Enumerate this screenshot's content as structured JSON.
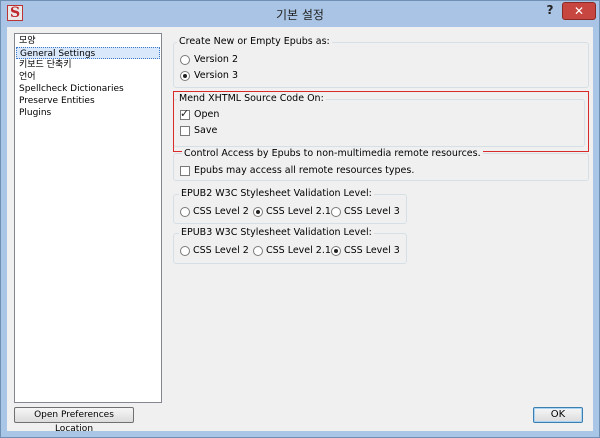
{
  "window": {
    "title": "기본 설정",
    "help_label": "?",
    "close_label": "✕",
    "app_icon_glyph": "S"
  },
  "sidebar": {
    "items": [
      {
        "label": "모양",
        "selected": false
      },
      {
        "label": "General Settings",
        "selected": true
      },
      {
        "label": "키보드 단축키",
        "selected": false
      },
      {
        "label": "언어",
        "selected": false
      },
      {
        "label": "Spellcheck Dictionaries",
        "selected": false
      },
      {
        "label": "Preserve Entities",
        "selected": false
      },
      {
        "label": "Plugins",
        "selected": false
      }
    ]
  },
  "epub_version": {
    "title": "Create New or Empty Epubs as:",
    "options": [
      {
        "label": "Version 2",
        "checked": false
      },
      {
        "label": "Version 3",
        "checked": true
      }
    ]
  },
  "mend": {
    "title": "Mend XHTML Source Code On:",
    "options": [
      {
        "label": "Open",
        "checked": true
      },
      {
        "label": "Save",
        "checked": false
      }
    ]
  },
  "remote": {
    "title": "Control Access by Epubs to non-multimedia remote resources.",
    "option": {
      "label": "Epubs may access all remote resources types.",
      "checked": false
    }
  },
  "epub2_css": {
    "title": "EPUB2 W3C Stylesheet Validation Level:",
    "options": [
      {
        "label": "CSS Level 2",
        "checked": false
      },
      {
        "label": "CSS Level 2.1",
        "checked": true
      },
      {
        "label": "CSS Level 3",
        "checked": false
      }
    ]
  },
  "epub3_css": {
    "title": "EPUB3 W3C Stylesheet Validation Level:",
    "options": [
      {
        "label": "CSS Level 2",
        "checked": false
      },
      {
        "label": "CSS Level 2.1",
        "checked": false
      },
      {
        "label": "CSS Level 3",
        "checked": true
      }
    ]
  },
  "buttons": {
    "open_prefs": "Open Preferences Location",
    "ok": "OK"
  },
  "colors": {
    "titlebar": "#a9c4e4",
    "close": "#c7463f",
    "highlight": "#d92a2a",
    "selection": "#d9e8fb"
  }
}
